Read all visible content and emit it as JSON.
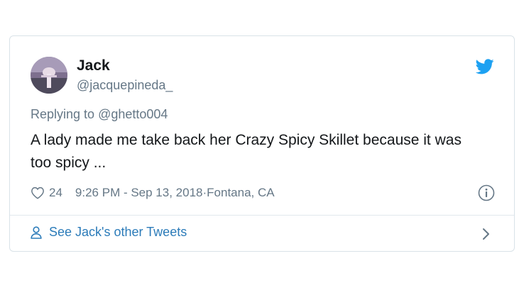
{
  "author": {
    "name": "Jack",
    "handle": "@jacquepineda_"
  },
  "reply": {
    "prefix": "Replying to ",
    "handle": "@ghetto004"
  },
  "tweet": {
    "text": "A lady made me take back her Crazy Spicy Skillet because it was too spicy ..."
  },
  "meta": {
    "likes": "24",
    "timestamp": "9:26 PM - Sep 13, 2018",
    "separator": " · ",
    "location": "Fontana, CA"
  },
  "footer": {
    "link_label": "See Jack's other Tweets"
  },
  "icons": {
    "brand": "twitter-bird-icon",
    "like": "heart-icon",
    "info": "info-icon",
    "profile": "person-icon",
    "more": "chevron-right-icon"
  },
  "colors": {
    "twitter_blue": "#1da1f2",
    "link_blue": "#2b7bb9",
    "text_dark": "#14171a",
    "text_gray": "#657786",
    "border": "#d9e2e8"
  }
}
